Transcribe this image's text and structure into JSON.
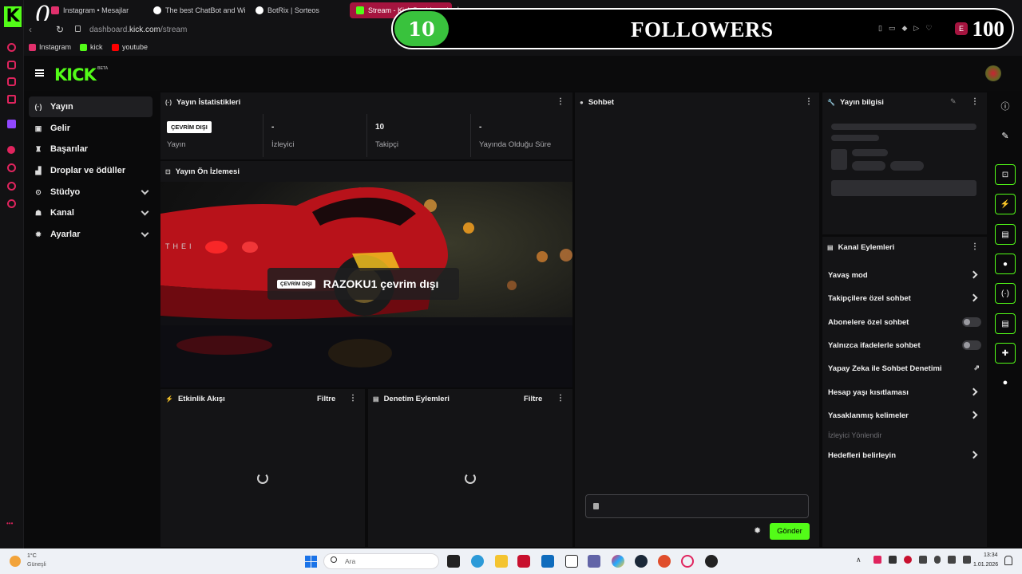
{
  "browser": {
    "tabs": [
      {
        "label": "Instagram • Mesajlar"
      },
      {
        "label": "The best ChatBot and Wi..."
      },
      {
        "label": "BotRix | Sorteos"
      },
      {
        "label": "Stream - Kick Dashboard"
      }
    ],
    "url_prefix": "dashboard.",
    "url_host": "kick.com",
    "url_path": "/stream",
    "bookmarks": [
      {
        "label": "Instagram"
      },
      {
        "label": "kick"
      },
      {
        "label": "youtube"
      }
    ],
    "overlay_letter": "0"
  },
  "followers_overlay": {
    "current": "10",
    "label": "FOLLOWERS",
    "goal": "100"
  },
  "kick": {
    "logo": "KICK",
    "beta": "BETA"
  },
  "sidebar": {
    "items": [
      {
        "label": "Yayın",
        "icon": "broadcast-icon"
      },
      {
        "label": "Gelir",
        "icon": "revenue-icon"
      },
      {
        "label": "Başarılar",
        "icon": "trophy-icon"
      },
      {
        "label": "Droplar ve ödüller",
        "icon": "gift-icon"
      },
      {
        "label": "Stüdyo",
        "icon": "studio-icon"
      },
      {
        "label": "Kanal",
        "icon": "channel-icon"
      },
      {
        "label": "Ayarlar",
        "icon": "gear-icon"
      }
    ]
  },
  "stats": {
    "title": "Yayın İstatistikleri",
    "items": [
      {
        "value": "ÇEVRİM DIŞI",
        "label": "Yayın"
      },
      {
        "value": "-",
        "label": "İzleyici"
      },
      {
        "value": "10",
        "label": "Takipçi"
      },
      {
        "value": "-",
        "label": "Yayında Olduğu Süre"
      }
    ]
  },
  "preview": {
    "title": "Yayın Ön İzlemesi",
    "badge": "ÇEVRİM DIŞI",
    "message": "RAZOKU1 çevrim dışı",
    "car_text": "THEI"
  },
  "activity": {
    "title": "Etkinlik Akışı",
    "filter": "Filtre"
  },
  "moderation": {
    "title": "Denetim Eylemleri",
    "filter": "Filtre"
  },
  "chat": {
    "title": "Sohbet",
    "send": "Gönder"
  },
  "stream_info": {
    "title": "Yayın bilgisi"
  },
  "channel_actions": {
    "title": "Kanal Eylemleri",
    "items": [
      {
        "label": "Yavaş mod",
        "control": "chevron"
      },
      {
        "label": "Takipçilere özel sohbet",
        "control": "chevron"
      },
      {
        "label": "Abonelere özel sohbet",
        "control": "toggle"
      },
      {
        "label": "Yalnızca ifadelerle sohbet",
        "control": "toggle"
      },
      {
        "label": "Yapay Zeka ile Sohbet Denetimi",
        "control": "external"
      },
      {
        "label": "Hesap yaşı kısıtlaması",
        "control": "chevron"
      },
      {
        "label": "Yasaklanmış kelimeler",
        "control": "chevron"
      }
    ],
    "section": "İzleyici Yönlendir",
    "goals": "Hedefleri belirleyin"
  },
  "taskbar": {
    "weather_temp": "1°C",
    "weather_desc": "Güneşli",
    "search_placeholder": "Ara",
    "time": "13:34",
    "date": "1.01.2026"
  },
  "colors": {
    "accent": "#53fc18",
    "panel": "#141416",
    "background": "#0a0a0b",
    "overlay_green": "#39c23d"
  }
}
